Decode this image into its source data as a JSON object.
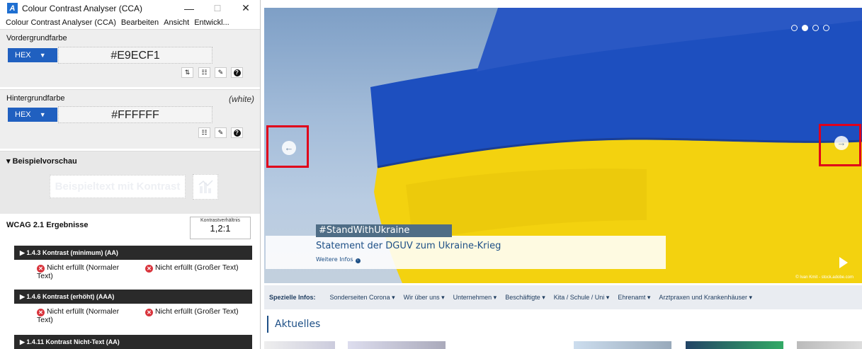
{
  "cca": {
    "title": "Colour Contrast Analyser (CCA)",
    "window_controls": {
      "minimize": "—",
      "maximize": "☐",
      "close": "✕"
    },
    "menu": [
      "Colour Contrast Analyser (CCA)",
      "Bearbeiten",
      "Ansicht",
      "Entwickl..."
    ],
    "foreground": {
      "heading": "Vordergrundfarbe",
      "format": "HEX",
      "value": "#E9ECF1"
    },
    "background": {
      "heading": "Hintergrundfarbe",
      "note": "(white)",
      "format": "HEX",
      "value": "#FFFFFF"
    },
    "preview": {
      "heading": "▾ Beispielvorschau",
      "sample_text": "Beispieltext mit Kontrast"
    },
    "results": {
      "heading": "WCAG 2.1 Ergebnisse",
      "ratio_label": "Kontrastverhältnis",
      "ratio_value": "1,2:1",
      "criteria": [
        {
          "title": "▶ 1.4.3 Kontrast (minimum) (AA)",
          "normal": "Nicht erfüllt (Normaler Text)",
          "large": "Nicht erfüllt (Großer Text)"
        },
        {
          "title": "▶ 1.4.6 Kontrast (erhöht) (AAA)",
          "normal": "Nicht erfüllt (Normaler Text)",
          "large": "Nicht erfüllt (Großer Text)"
        },
        {
          "title": "▶ 1.4.11 Kontrast Nicht-Text (AA)"
        }
      ]
    }
  },
  "website": {
    "hero": {
      "tag": "#StandWithUkraine",
      "title": "Statement der DGUV zum Ukraine-Krieg",
      "more": "Weitere Infos",
      "credit": "© Ivan Kmit - stock.adobe.com",
      "slides": 4,
      "active_slide": 2
    },
    "nav": {
      "lead": "Spezielle Infos:",
      "items": [
        "Sonderseiten Corona ▾",
        "Wir über uns ▾",
        "Unternehmen ▾",
        "Beschäftigte ▾",
        "Kita / Schule / Uni ▾",
        "Ehrenamt ▾",
        "Arztpraxen und Krankenhäuser ▾"
      ]
    },
    "section_title": "Aktuelles"
  },
  "colors": {
    "flag_blue": "#1d4fbf",
    "flag_yellow": "#f3d20f",
    "highlight_red": "#e0001a",
    "nav_bg": "#e9ecf1"
  }
}
